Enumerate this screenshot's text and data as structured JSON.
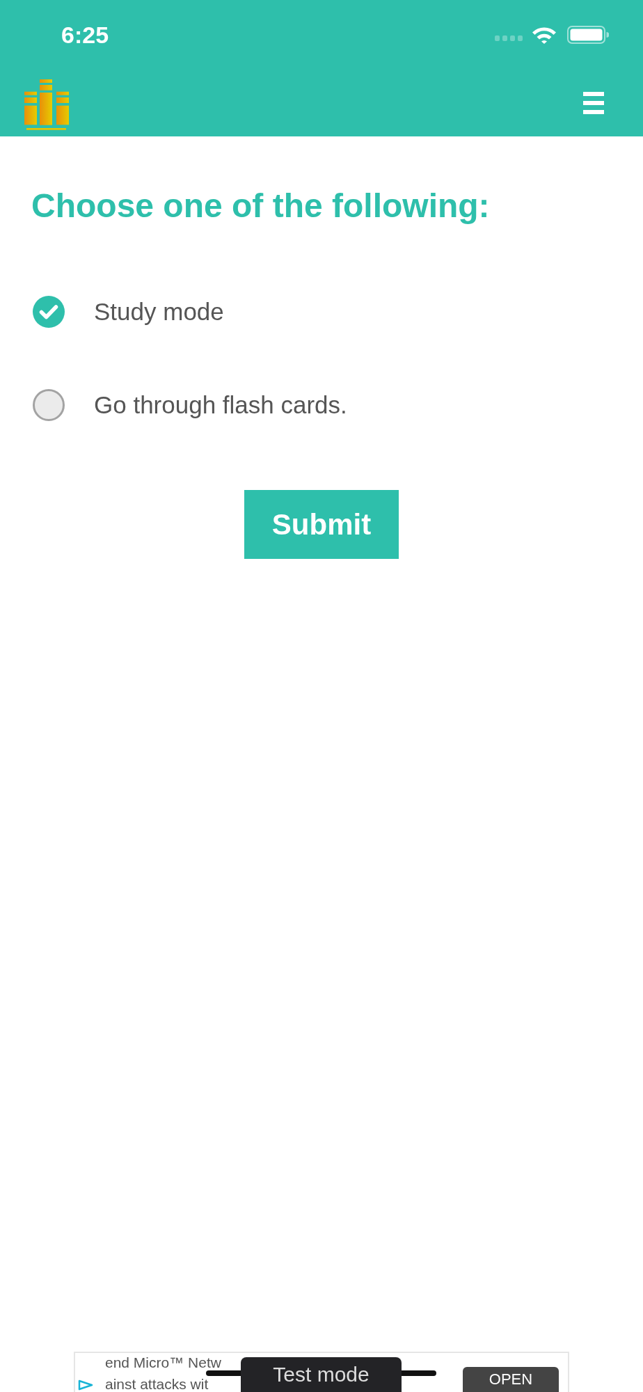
{
  "status_bar": {
    "time": "6:25"
  },
  "question": {
    "prompt": "Choose one of the following:",
    "options": [
      {
        "label": "Study mode",
        "selected": true
      },
      {
        "label": "Go through flash cards.",
        "selected": false
      }
    ],
    "submit": "Submit"
  },
  "ad_banner": {
    "lines": [
      "end Micro™ Netw",
      "ainst attacks wit"
    ],
    "button": "OPEN"
  },
  "toast": {
    "text": "Test mode"
  }
}
